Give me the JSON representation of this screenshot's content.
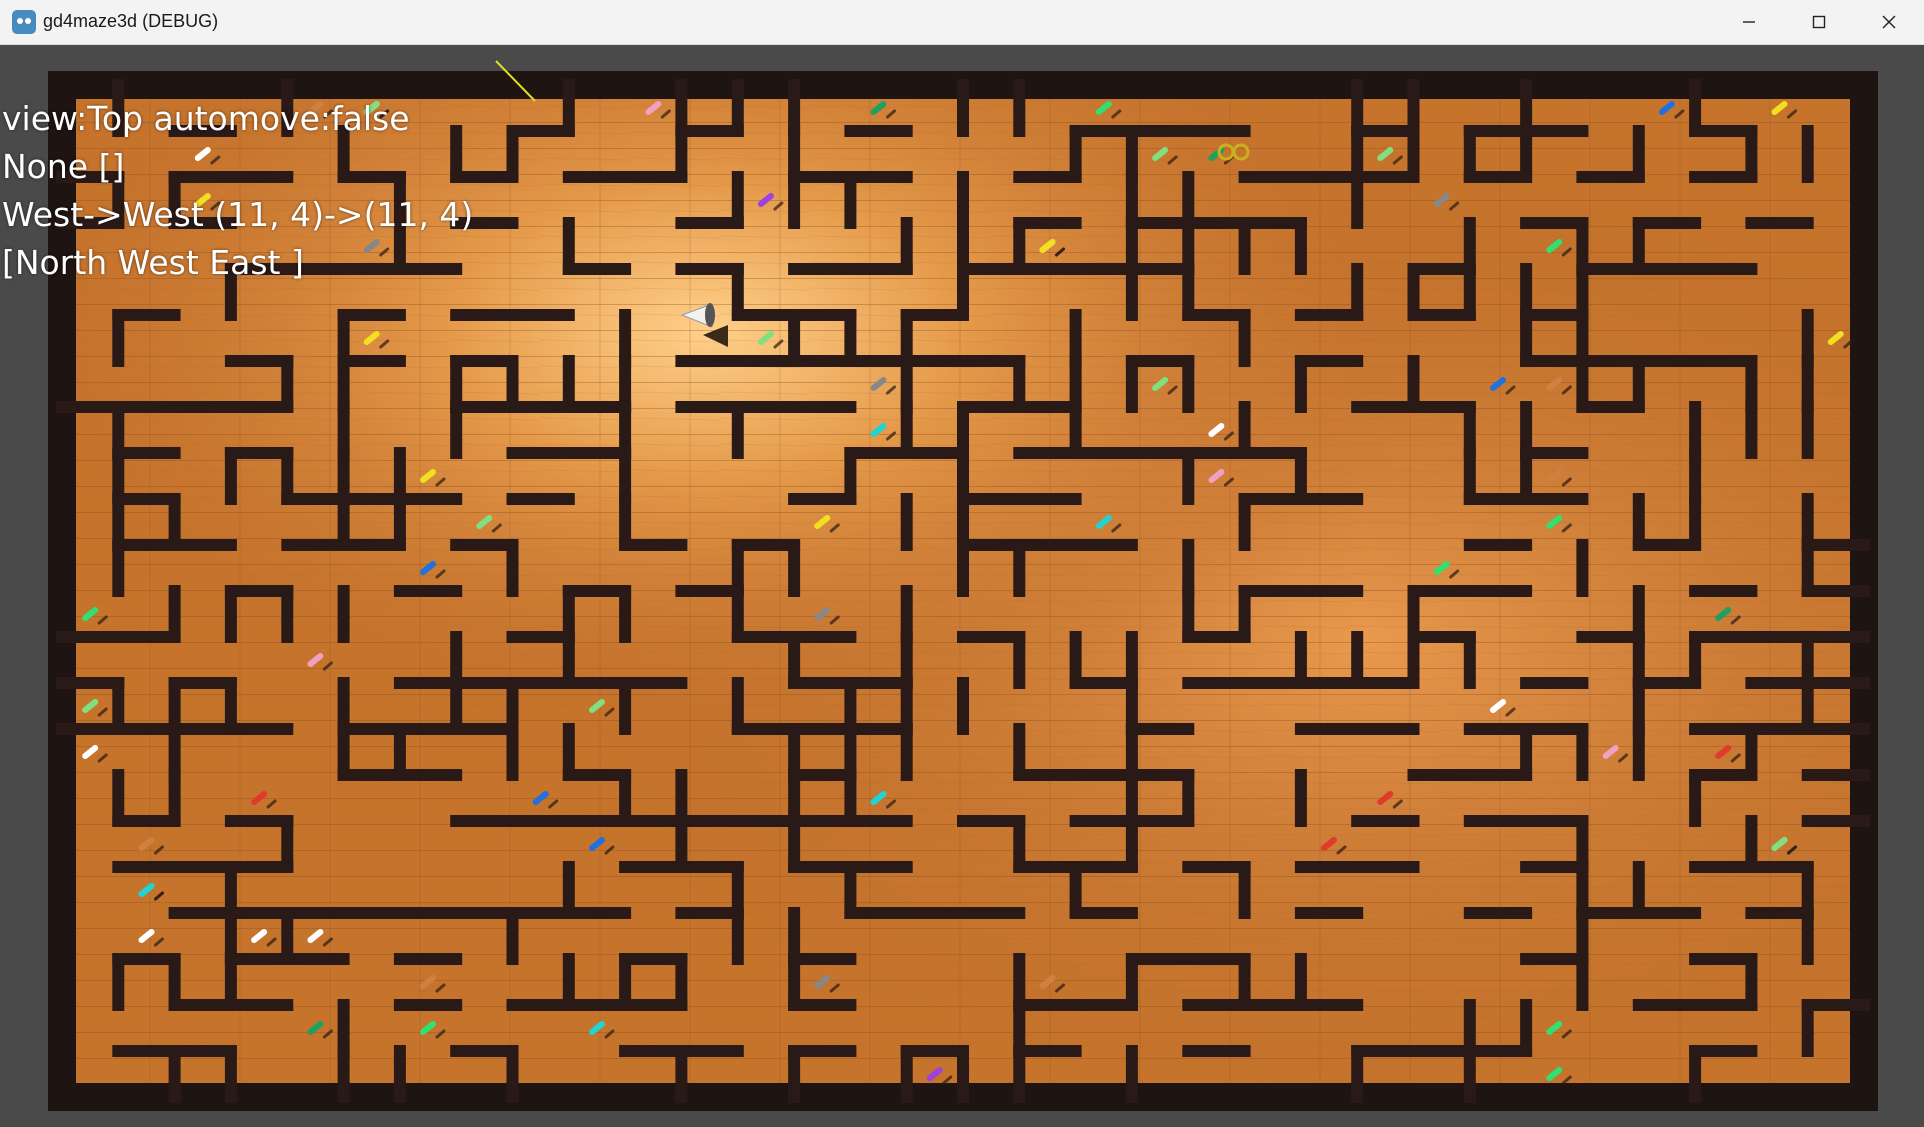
{
  "window": {
    "title": "gd4maze3d (DEBUG)",
    "controls": [
      "minimize",
      "maximize",
      "close"
    ]
  },
  "hud": {
    "line1": "view:Top automove:false",
    "line2": "None []",
    "line3": "West->West (11, 4)->(11, 4)",
    "line4": "[North West East ]"
  },
  "colors": {
    "floor": "#c6742c",
    "floor_light": "#f0a04e",
    "wall": "#2a1a17",
    "frame": "#1e1412"
  },
  "icons": [
    "godot-app-icon",
    "minimize-icon",
    "maximize-icon",
    "close-icon",
    "player-cone",
    "start-marker"
  ]
}
